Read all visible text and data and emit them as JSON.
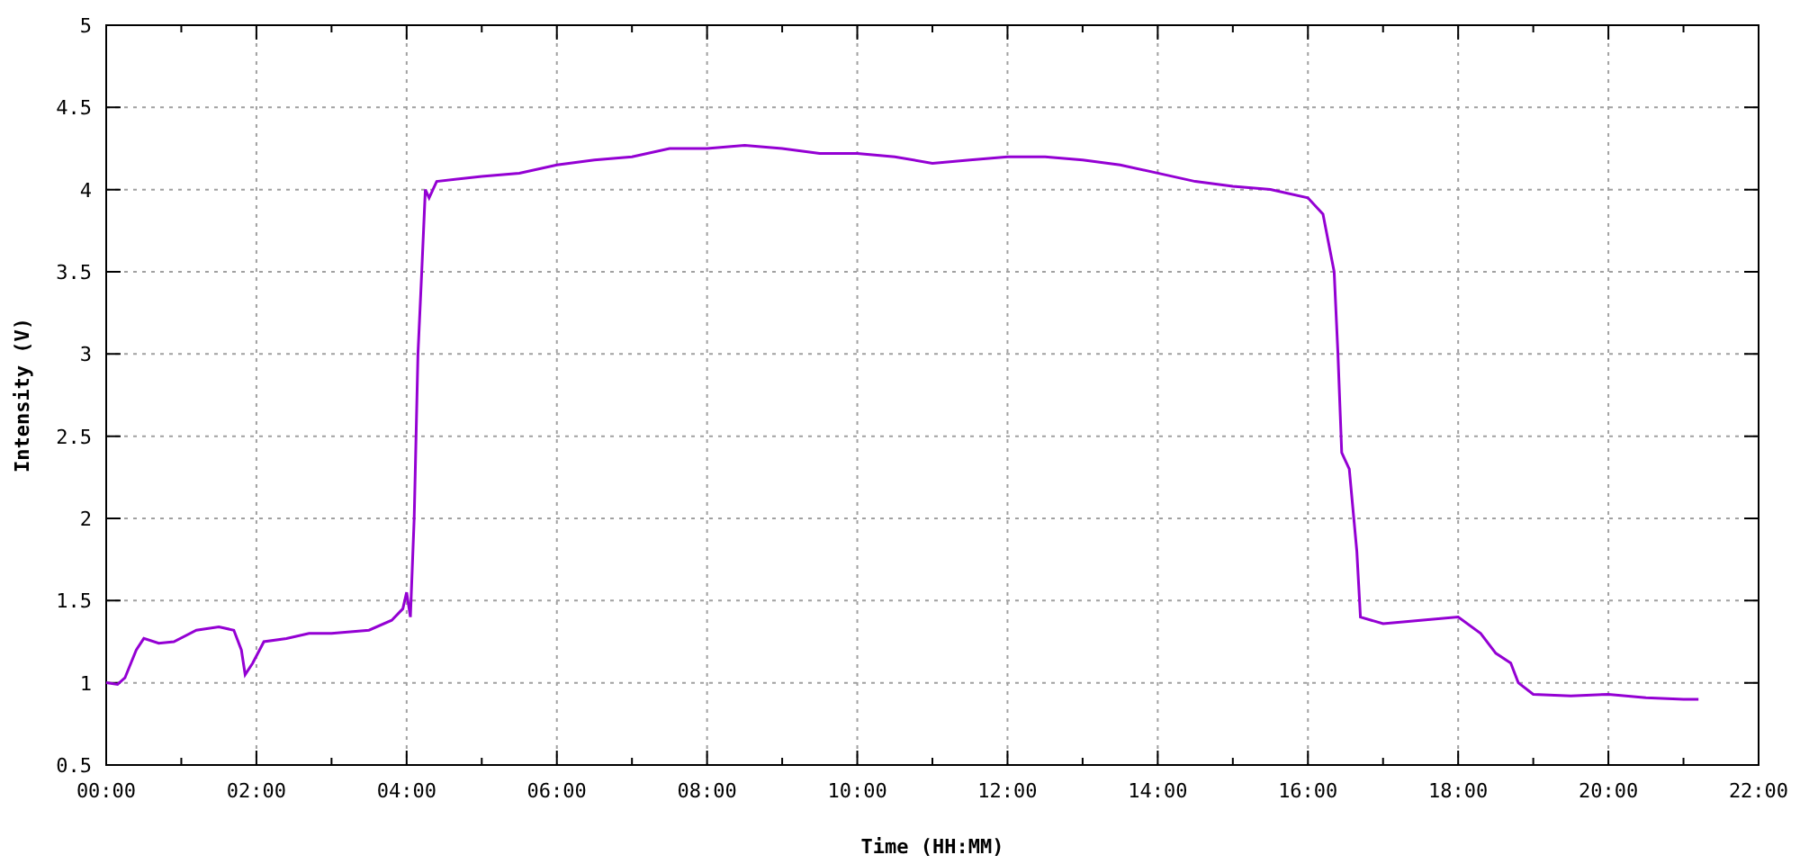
{
  "chart_data": {
    "type": "line",
    "grid": true,
    "xlabel": "Time (HH:MM)",
    "ylabel": "Intensity (V)",
    "xlim": [
      0,
      22
    ],
    "ylim": [
      0.5,
      5
    ],
    "xticks": [
      {
        "value": 0,
        "label": "00:00"
      },
      {
        "value": 2,
        "label": "02:00"
      },
      {
        "value": 4,
        "label": "04:00"
      },
      {
        "value": 6,
        "label": "06:00"
      },
      {
        "value": 8,
        "label": "08:00"
      },
      {
        "value": 10,
        "label": "10:00"
      },
      {
        "value": 12,
        "label": "12:00"
      },
      {
        "value": 14,
        "label": "14:00"
      },
      {
        "value": 16,
        "label": "16:00"
      },
      {
        "value": 18,
        "label": "18:00"
      },
      {
        "value": 20,
        "label": "20:00"
      },
      {
        "value": 22,
        "label": "22:00"
      }
    ],
    "yticks": [
      {
        "value": 0.5,
        "label": "0.5"
      },
      {
        "value": 1,
        "label": "1"
      },
      {
        "value": 1.5,
        "label": "1.5"
      },
      {
        "value": 2,
        "label": "2"
      },
      {
        "value": 2.5,
        "label": "2.5"
      },
      {
        "value": 3,
        "label": "3"
      },
      {
        "value": 3.5,
        "label": "3.5"
      },
      {
        "value": 4,
        "label": "4"
      },
      {
        "value": 4.5,
        "label": "4.5"
      },
      {
        "value": 5,
        "label": "5"
      }
    ],
    "x": [
      0,
      0.15,
      0.25,
      0.4,
      0.5,
      0.7,
      0.9,
      1.2,
      1.5,
      1.7,
      1.8,
      1.85,
      1.95,
      2.1,
      2.4,
      2.7,
      3.0,
      3.5,
      3.8,
      3.95,
      4.0,
      4.05,
      4.1,
      4.15,
      4.2,
      4.25,
      4.3,
      4.4,
      5,
      5.5,
      6,
      6.5,
      7,
      7.5,
      8,
      8.5,
      9,
      9.5,
      10,
      10.5,
      11,
      11.5,
      12,
      12.5,
      13,
      13.5,
      14,
      14.5,
      15,
      15.5,
      16,
      16.2,
      16.35,
      16.4,
      16.45,
      16.55,
      16.65,
      16.7,
      17,
      17.5,
      18,
      18.3,
      18.5,
      18.7,
      18.8,
      19,
      19.5,
      20,
      20.5,
      21,
      21.2
    ],
    "series": [
      {
        "color": "#9400d3",
        "values": [
          1.0,
          0.99,
          1.03,
          1.2,
          1.27,
          1.24,
          1.25,
          1.32,
          1.34,
          1.32,
          1.2,
          1.05,
          1.12,
          1.25,
          1.27,
          1.3,
          1.3,
          1.32,
          1.38,
          1.45,
          1.55,
          1.4,
          2.0,
          3.0,
          3.5,
          4.0,
          3.95,
          4.05,
          4.08,
          4.1,
          4.15,
          4.18,
          4.2,
          4.25,
          4.25,
          4.27,
          4.25,
          4.22,
          4.22,
          4.2,
          4.16,
          4.18,
          4.2,
          4.2,
          4.18,
          4.15,
          4.1,
          4.05,
          4.02,
          4.0,
          3.95,
          3.85,
          3.5,
          3.0,
          2.4,
          2.3,
          1.8,
          1.4,
          1.36,
          1.38,
          1.4,
          1.3,
          1.18,
          1.12,
          1.0,
          0.93,
          0.92,
          0.93,
          0.91,
          0.9,
          0.9
        ]
      }
    ]
  }
}
